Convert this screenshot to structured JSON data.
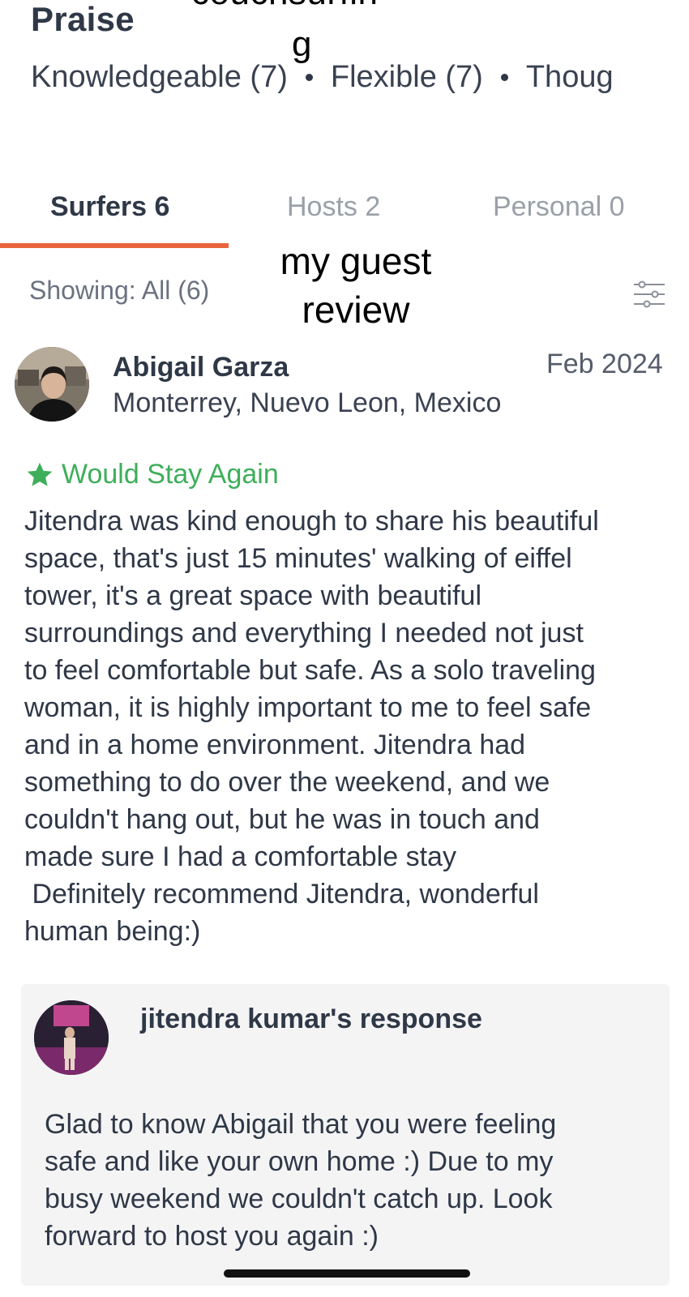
{
  "overlay": {
    "top_text": "couchsurfin",
    "top_text_g": "g",
    "guest_review_line1": "my guest",
    "guest_review_line2": "review"
  },
  "praise": {
    "title": "Praise",
    "items": [
      {
        "label": "Knowledgeable (7)"
      },
      {
        "label": "Flexible (7)"
      },
      {
        "label": "Thoug"
      }
    ]
  },
  "tabs": [
    {
      "label": "Surfers 6",
      "active": true
    },
    {
      "label": "Hosts 2",
      "active": false
    },
    {
      "label": "Personal 0",
      "active": false
    }
  ],
  "filter": {
    "showing": "Showing: All (6)",
    "icon": "sliders-icon"
  },
  "review": {
    "name": "Abigail Garza",
    "date": "Feb 2024",
    "location": "Monterrey, Nuevo Leon, Mexico",
    "badge": "Would Stay Again",
    "badge_color": "#3fae5a",
    "body": "Jitendra was kind enough to share his beautiful\nspace, that's just 15 minutes' walking of eiffel\ntower, it's a great space with beautiful\nsurroundings and everything I needed not just\nto feel comfortable but safe. As a solo traveling\nwoman, it is highly important to me to feel safe\nand in a home environment. Jitendra had\nsomething to do over the weekend, and we\ncouldn't hang out, but he was in touch and\nmade sure I had a comfortable stay\n Definitely recommend Jitendra, wonderful\nhuman being:)"
  },
  "response": {
    "title": "jitendra kumar's response",
    "body": "Glad to know Abigail that you were feeling\nsafe and like your own home :) Due to my\nbusy weekend we couldn't catch up. Look\nforward to host you again :)"
  },
  "colors": {
    "accent": "#e8643d",
    "text_dark": "#2f3847",
    "text_muted": "#9aa0a8"
  }
}
